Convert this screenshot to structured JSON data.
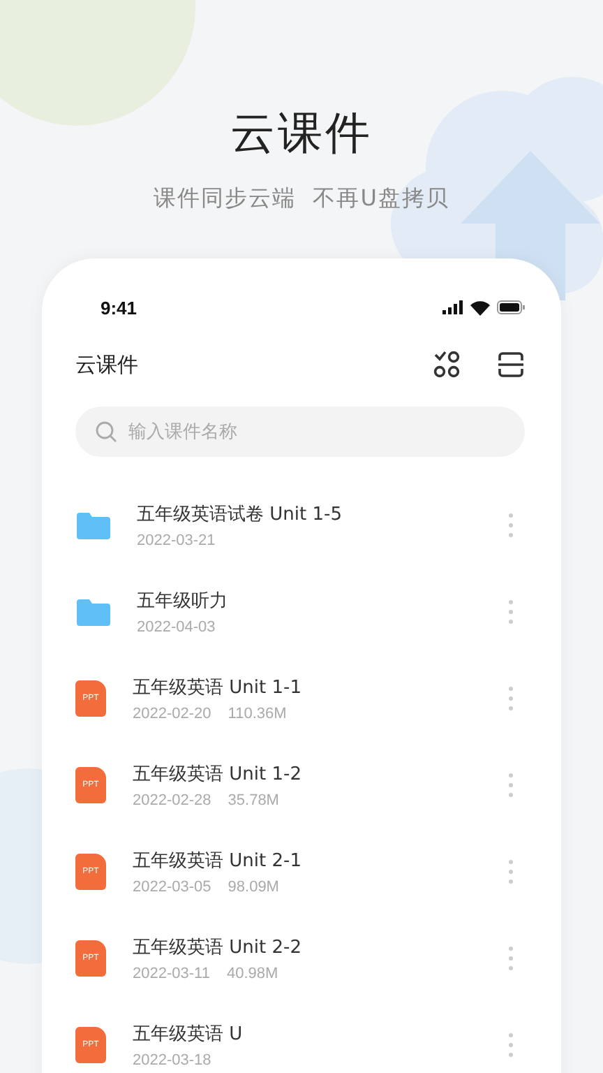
{
  "header": {
    "title": "云课件",
    "subtitle": "课件同步云端  不再U盘拷贝"
  },
  "status_bar": {
    "time": "9:41"
  },
  "app_bar": {
    "title": "云课件"
  },
  "search": {
    "placeholder": "输入课件名称"
  },
  "files": [
    {
      "kind": "folder",
      "name": "五年级英语试卷 Unit 1-5",
      "date": "2022-03-21"
    },
    {
      "kind": "folder",
      "name": "五年级听力",
      "date": "2022-04-03"
    },
    {
      "kind": "ppt",
      "badge": "PPT",
      "name": "五年级英语 Unit 1-1",
      "date": "2022-02-20",
      "size": "110.36M"
    },
    {
      "kind": "ppt",
      "badge": "PPT",
      "name": "五年级英语 Unit 1-2",
      "date": "2022-02-28",
      "size": "35.78M"
    },
    {
      "kind": "ppt",
      "badge": "PPT",
      "name": "五年级英语 Unit 2-1",
      "date": "2022-03-05",
      "size": "98.09M"
    },
    {
      "kind": "ppt",
      "badge": "PPT",
      "name": "五年级英语 Unit 2-2",
      "date": "2022-03-11",
      "size": "40.98M"
    },
    {
      "kind": "ppt",
      "badge": "PPT",
      "name": "五年级英语 U",
      "date": "2022-03-18"
    }
  ]
}
